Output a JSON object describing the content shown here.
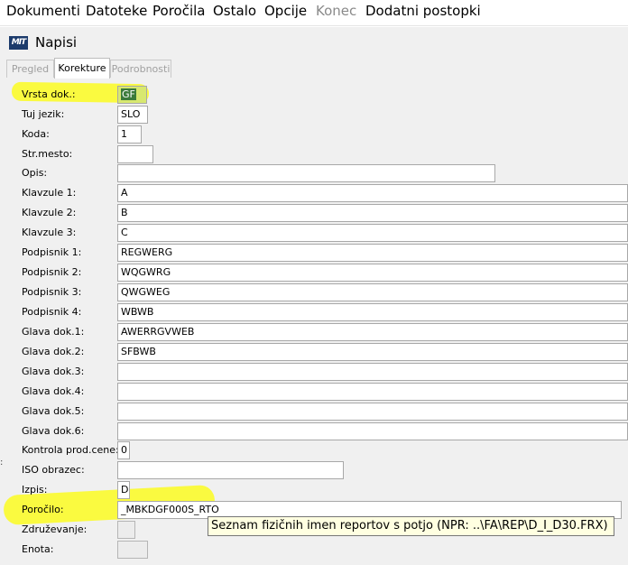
{
  "menu": {
    "items": [
      {
        "label": "Dokumenti",
        "enabled": true
      },
      {
        "label": "Datoteke",
        "enabled": true
      },
      {
        "label": "Poročila",
        "enabled": true
      },
      {
        "label": "Ostalo",
        "enabled": true
      },
      {
        "label": "Opcije",
        "enabled": true
      },
      {
        "label": "Konec",
        "enabled": false
      },
      {
        "label": "Dodatni postopki",
        "enabled": true
      }
    ]
  },
  "window": {
    "title": "Napisi",
    "icon": "app-logo-icon"
  },
  "tabs": [
    {
      "label": "Pregled",
      "active": false
    },
    {
      "label": "Korekture",
      "active": true
    },
    {
      "label": "Podrobnosti",
      "active": false
    }
  ],
  "form": {
    "fields": [
      {
        "label": "Vrsta dok.:",
        "value": "GF",
        "selected": true
      },
      {
        "label": "Tuj jezik:",
        "value": "SLO"
      },
      {
        "label": "Koda:",
        "value": "1"
      },
      {
        "label": "Str.mesto:",
        "value": ""
      },
      {
        "label": "Opis:",
        "value": ""
      },
      {
        "label": "Klavzule 1:",
        "value": "A"
      },
      {
        "label": "Klavzule 2:",
        "value": "B"
      },
      {
        "label": "Klavzule 3:",
        "value": "C"
      },
      {
        "label": "Podpisnik 1:",
        "value": "REGWERG"
      },
      {
        "label": "Podpisnik 2:",
        "value": "WQGWRG"
      },
      {
        "label": "Podpisnik 3:",
        "value": "QWGWEG"
      },
      {
        "label": "Podpisnik 4:",
        "value": "WBWB"
      },
      {
        "label": "Glava dok.1:",
        "value": "AWERRGVWEB"
      },
      {
        "label": "Glava dok.2:",
        "value": "SFBWB"
      },
      {
        "label": "Glava dok.3:",
        "value": ""
      },
      {
        "label": "Glava dok.4:",
        "value": ""
      },
      {
        "label": "Glava dok.5:",
        "value": ""
      },
      {
        "label": "Glava dok.6:",
        "value": ""
      },
      {
        "label": "Kontrola prod.cene:",
        "value": "0"
      },
      {
        "label": "ISO obrazec:",
        "value": ""
      },
      {
        "label": "Izpis:",
        "value": "D"
      },
      {
        "label": "Poročilo:",
        "value": "_MBKDGF000S_RTO"
      },
      {
        "label": "Združevanje:",
        "value": "",
        "disabled": true
      },
      {
        "label": "Enota:",
        "value": "",
        "disabled": true
      }
    ]
  },
  "tooltip": {
    "text": "Seznam fizičnih imen reportov s potjo (NPR: ..\\FA\\REP\\D_I_D30.FRX)"
  },
  "colors": {
    "highlight": "#fbfb21",
    "tooltip_bg": "#ffffe1",
    "window_bg": "#f0f0f0"
  }
}
